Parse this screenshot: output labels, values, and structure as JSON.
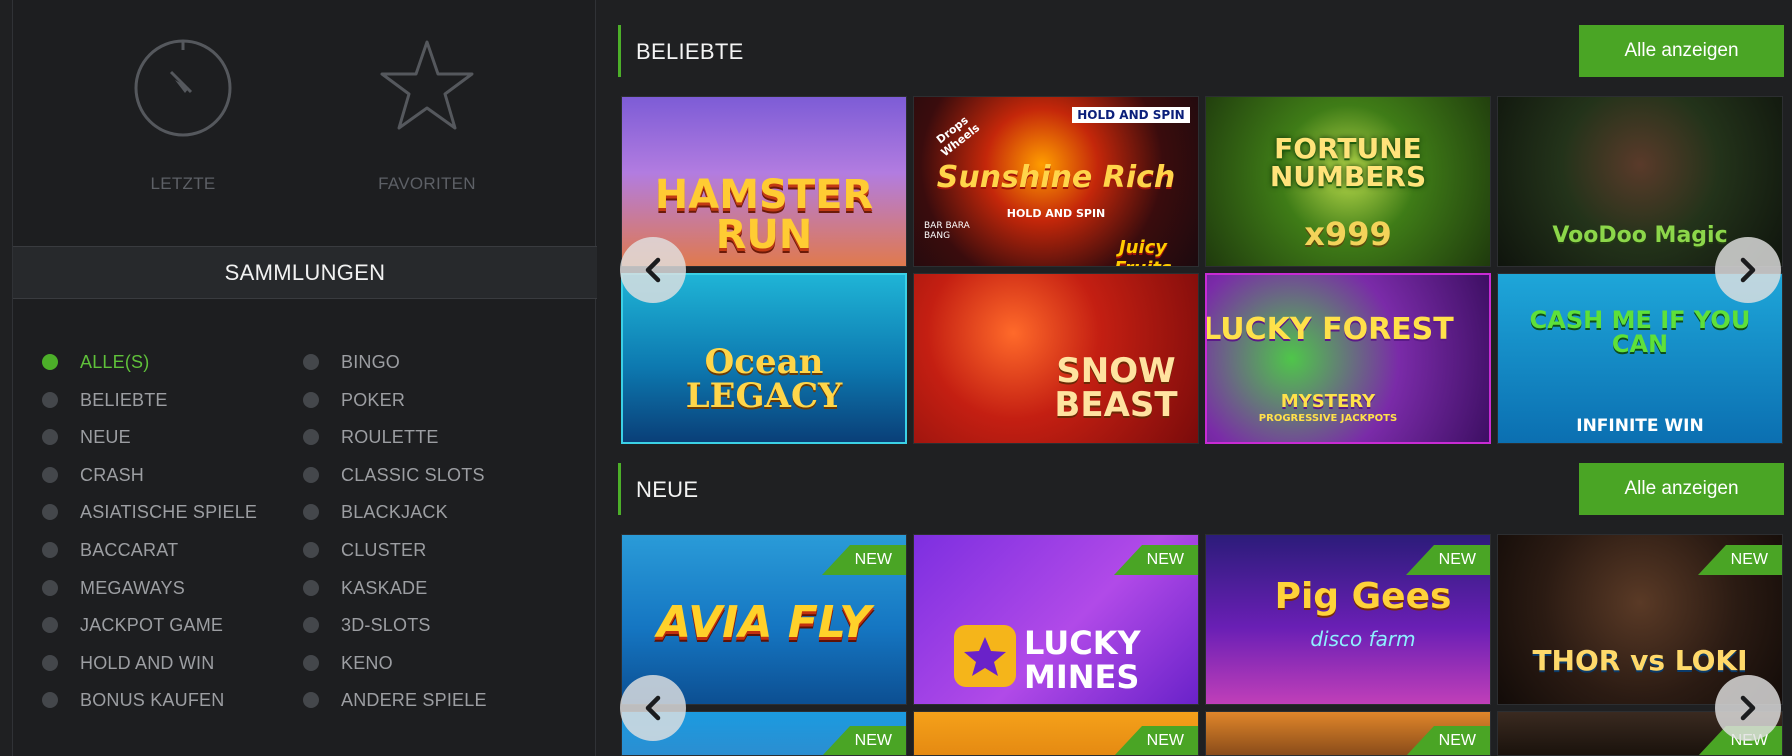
{
  "sidebar": {
    "recent_label": "LETZTE",
    "favorites_label": "FAVORITEN",
    "collections_title": "SAMMLUNGEN",
    "collections": [
      {
        "label": "ALLE(S)",
        "active": true
      },
      {
        "label": "BELIEBTE",
        "active": false
      },
      {
        "label": "NEUE",
        "active": false
      },
      {
        "label": "CRASH",
        "active": false
      },
      {
        "label": "ASIATISCHE SPIELE",
        "active": false
      },
      {
        "label": "BACCARAT",
        "active": false
      },
      {
        "label": "MEGAWAYS",
        "active": false
      },
      {
        "label": "JACKPOT GAME",
        "active": false
      },
      {
        "label": "HOLD AND WIN",
        "active": false
      },
      {
        "label": "BONUS KAUFEN",
        "active": false
      },
      {
        "label": "BINGO",
        "active": false
      },
      {
        "label": "POKER",
        "active": false
      },
      {
        "label": "ROULETTE",
        "active": false
      },
      {
        "label": "CLASSIC SLOTS",
        "active": false
      },
      {
        "label": "BLACKJACK",
        "active": false
      },
      {
        "label": "CLUSTER",
        "active": false
      },
      {
        "label": "KASKADE",
        "active": false
      },
      {
        "label": "3D-SLOTS",
        "active": false
      },
      {
        "label": "KENO",
        "active": false
      },
      {
        "label": "ANDERE SPIELE",
        "active": false
      }
    ]
  },
  "popular": {
    "title": "BELIEBTE",
    "show_all": "Alle anzeigen",
    "games": [
      {
        "name": "HAMSTER RUN"
      },
      {
        "name": "Sunshine Rich",
        "tag": "HOLD AND SPIN",
        "sub": "HOLD AND SPIN",
        "brand": "Juicy Fruits",
        "corner": "Drops Wheels",
        "provider": "BAR BARA BANG"
      },
      {
        "name": "FORTUNE NUMBERS",
        "sub": "x999"
      },
      {
        "name": "VooDoo Magic"
      },
      {
        "name": "Ocean LEGACY"
      },
      {
        "name": "SNOW BEAST"
      },
      {
        "name": "LUCKY FOREST",
        "sub": "MYSTERY",
        "sub2": "PROGRESSIVE JACKPOTS"
      },
      {
        "name": "CASH ME IF YOU CAN",
        "sub": "INFINITE WIN"
      }
    ]
  },
  "new": {
    "title": "NEUE",
    "show_all": "Alle anzeigen",
    "badge": "NEW",
    "games": [
      {
        "name": "AVIA FLY"
      },
      {
        "name": "LUCKY MINES"
      },
      {
        "name": "Pig Gees",
        "sub": "disco farm"
      },
      {
        "name": "THOR vs LOKI"
      },
      {
        "name": ""
      },
      {
        "name": ""
      },
      {
        "name": ""
      },
      {
        "name": ""
      }
    ]
  },
  "icons": {
    "recent": "stopwatch-icon",
    "favorites": "star-icon",
    "prev": "chevron-left-icon",
    "next": "chevron-right-icon"
  },
  "colors": {
    "accent": "#4aa525",
    "active_text": "#5fc13a",
    "background": "#1f2022"
  }
}
